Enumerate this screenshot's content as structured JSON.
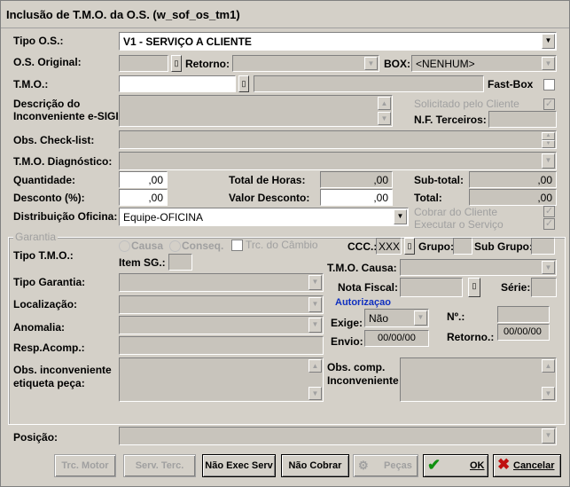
{
  "window": {
    "title": "Inclusão de T.M.O. da O.S. (w_sof_os_tm1)"
  },
  "labels": {
    "tipo_os": "Tipo O.S.:",
    "os_original": "O.S. Original:",
    "retorno": "Retorno:",
    "box": "BOX:",
    "tmo": "T.M.O.:",
    "fast_box": "Fast-Box",
    "descricao1": "Descrição do",
    "descricao2": "Inconveniente e-SIGI",
    "solicitado": "Solicitado pelo Cliente",
    "nf_terceiros": "N.F. Terceiros:",
    "obs_checklist": "Obs. Check-list:",
    "tmo_diag": "T.M.O. Diagnóstico:",
    "quantidade": "Quantidade:",
    "total_horas": "Total de Horas:",
    "subtotal": "Sub-total:",
    "desconto": "Desconto (%):",
    "valor_desconto": "Valor Desconto:",
    "total": "Total:",
    "distribuicao": "Distribuição Oficina:",
    "cobrar": "Cobrar do Cliente",
    "executar": "Executar o Serviço",
    "garantia": "Garantia",
    "tipo_tmo": "Tipo T.M.O.:",
    "causa": "Causa",
    "conseq": "Conseq.",
    "trc_cambio": "Trc. do Câmbio",
    "item_sg": "Item SG.:",
    "ccc": "CCC.:",
    "grupo": "Grupo:",
    "sub_grupo": "Sub Grupo:",
    "tmo_causa": "T.M.O. Causa:",
    "tipo_garantia": "Tipo Garantia:",
    "nota_fiscal": "Nota Fiscal:",
    "serie": "Série:",
    "localizacao": "Localização:",
    "autorizacao": "Autorizaçao",
    "exige": "Exige:",
    "no": "Nº.:",
    "anomalia": "Anomalia:",
    "envio": "Envio:",
    "retorno2": "Retorno.:",
    "resp_acomp": "Resp.Acomp.:",
    "obs_inconv1": "Obs. inconveniente",
    "obs_inconv2": "etiqueta peça:",
    "obs_comp1": "Obs. comp.",
    "obs_comp2": "Inconveniente",
    "posicao": "Posição:"
  },
  "values": {
    "tipo_os": "V1 - SERVIÇO A CLIENTE",
    "box": "<NENHUM>",
    "quantidade": ",00",
    "total_horas": ",00",
    "subtotal": ",00",
    "desconto": ",00",
    "valor_desconto": ",00",
    "total": ",00",
    "distribuicao": "Equipe-OFICINA",
    "ccc": "XXX",
    "exige": "Não",
    "envio": "00/00/00",
    "retorno2": "00/00/00"
  },
  "buttons": {
    "trc_motor": "Trc. Motor",
    "serv_terc": "Serv. Terc.",
    "nao_exec_serv": "Não Exec Serv",
    "nao_cobrar": "Não Cobrar",
    "pecas": "Peças",
    "ok": "OK",
    "cancelar": "Cancelar"
  },
  "colors": {
    "window_bg": "#d4d0c8",
    "disabled_text": "#a0a0a0",
    "ok_icon": "#109010",
    "cancel_icon": "#c01010",
    "autorizacao_text": "#1030c0"
  }
}
